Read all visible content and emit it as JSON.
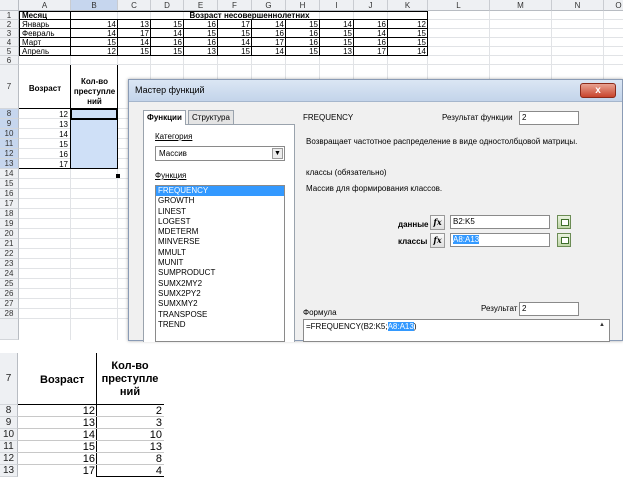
{
  "columns": [
    "A",
    "B",
    "C",
    "D",
    "E",
    "F",
    "G",
    "H",
    "I",
    "J",
    "K",
    "L",
    "M",
    "N",
    "O"
  ],
  "rows": [
    "1",
    "2",
    "3",
    "4",
    "5",
    "6",
    "7",
    "8",
    "9",
    "10",
    "11",
    "12",
    "13",
    "14",
    "15",
    "16",
    "17",
    "18",
    "19",
    "20",
    "21",
    "22",
    "23",
    "24",
    "25",
    "26",
    "27",
    "28"
  ],
  "sheet": {
    "header_month": "Месяц",
    "header_age": "Возраст несовершеннолетних",
    "months": [
      "Январь",
      "Февраль",
      "Март",
      "Апрель"
    ],
    "values": [
      [
        "14",
        "13",
        "15",
        "16",
        "17",
        "14",
        "15",
        "14",
        "16",
        "12"
      ],
      [
        "14",
        "17",
        "14",
        "15",
        "15",
        "16",
        "16",
        "15",
        "14",
        "15"
      ],
      [
        "15",
        "14",
        "16",
        "16",
        "14",
        "17",
        "16",
        "15",
        "16",
        "15"
      ],
      [
        "12",
        "15",
        "15",
        "13",
        "15",
        "14",
        "15",
        "13",
        "17",
        "14"
      ]
    ],
    "col_a7": "Возраст",
    "col_b7": "Кол-во преступле ний",
    "ages": [
      "12",
      "13",
      "14",
      "15",
      "16",
      "17"
    ]
  },
  "dialog": {
    "title": "Мастер функций",
    "close": "x",
    "tab_functions": "Функции",
    "tab_structure": "Структура",
    "category_label": "Категория",
    "category_value": "Массив",
    "function_label": "Функция",
    "functions": [
      "FREQUENCY",
      "GROWTH",
      "LINEST",
      "LOGEST",
      "MDETERM",
      "MINVERSE",
      "MMULT",
      "MUNIT",
      "SUMPRODUCT",
      "SUMX2MY2",
      "SUMX2PY2",
      "SUMXMY2",
      "TRANSPOSE",
      "TREND"
    ],
    "selected_function": "FREQUENCY",
    "func_name": "FREQUENCY",
    "result_label": "Результат функции",
    "result_value": "2",
    "description": "Возвращает частотное распределение в виде одностолбцовой матрицы.",
    "arg_title": "классы (обязательно)",
    "arg_desc": "Массив для формирования классов.",
    "arg1_label": "данные",
    "arg1_value": "B2:K5",
    "arg2_label": "классы",
    "arg2_value": "A8:A13",
    "fx": "fx",
    "formula_label": "Формула",
    "result2_label": "Результат",
    "result2_value": "2",
    "formula_prefix": "=FREQUENCY(B2:K5;",
    "formula_sel": "A8:A13",
    "formula_suffix": ")"
  },
  "zoom": {
    "row7": "7",
    "col_a": "Возраст",
    "col_b": "Кол-во преступле ний",
    "rows": [
      "8",
      "9",
      "10",
      "11",
      "12",
      "13"
    ],
    "ages": [
      "12",
      "13",
      "14",
      "15",
      "16",
      "17"
    ],
    "counts": [
      "2",
      "3",
      "10",
      "13",
      "8",
      "4"
    ]
  }
}
